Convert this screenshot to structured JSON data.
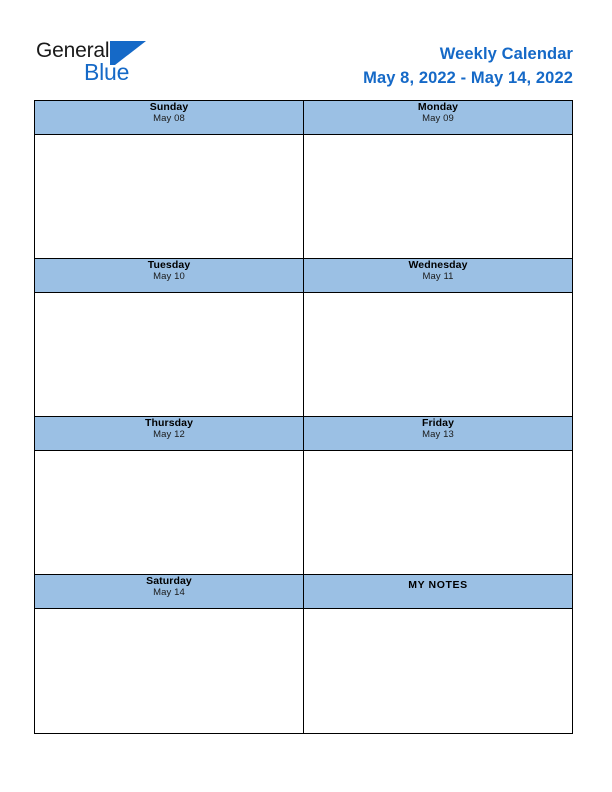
{
  "brand": {
    "word_one": "General",
    "word_two": "Blue",
    "mark": "triangle-logo",
    "color_dark": "#1a1a1a",
    "color_blue": "#1569c7"
  },
  "header": {
    "title": "Weekly Calendar",
    "date_range": "May 8, 2022 - May 14, 2022",
    "title_color": "#1569c7"
  },
  "theme": {
    "header_cell_bg": "#9bc0e4",
    "body_cell_bg": "#ffffff",
    "border_color": "#000000",
    "page_bg": "#ffffff"
  },
  "calendar": {
    "rows": [
      {
        "left": {
          "type": "day",
          "day": "Sunday",
          "date": "May 08",
          "note": ""
        },
        "right": {
          "type": "day",
          "day": "Monday",
          "date": "May 09",
          "note": ""
        }
      },
      {
        "left": {
          "type": "day",
          "day": "Tuesday",
          "date": "May 10",
          "note": ""
        },
        "right": {
          "type": "day",
          "day": "Wednesday",
          "date": "May 11",
          "note": ""
        }
      },
      {
        "left": {
          "type": "day",
          "day": "Thursday",
          "date": "May 12",
          "note": ""
        },
        "right": {
          "type": "day",
          "day": "Friday",
          "date": "May 13",
          "note": ""
        }
      },
      {
        "left": {
          "type": "day",
          "day": "Saturday",
          "date": "May 14",
          "note": ""
        },
        "right": {
          "type": "notes",
          "day": "MY NOTES",
          "date": "",
          "note": ""
        }
      }
    ]
  }
}
